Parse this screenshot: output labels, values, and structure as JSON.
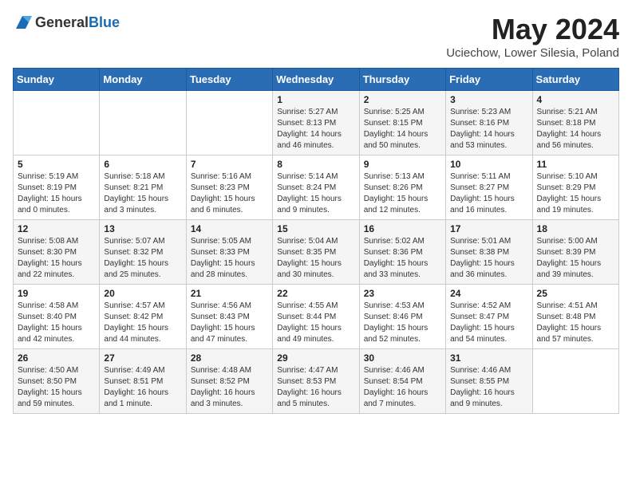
{
  "header": {
    "logo_general": "General",
    "logo_blue": "Blue",
    "month_title": "May 2024",
    "location": "Uciechow, Lower Silesia, Poland"
  },
  "days_of_week": [
    "Sunday",
    "Monday",
    "Tuesday",
    "Wednesday",
    "Thursday",
    "Friday",
    "Saturday"
  ],
  "weeks": [
    [
      {
        "day": "",
        "sunrise": "",
        "sunset": "",
        "daylight": ""
      },
      {
        "day": "",
        "sunrise": "",
        "sunset": "",
        "daylight": ""
      },
      {
        "day": "",
        "sunrise": "",
        "sunset": "",
        "daylight": ""
      },
      {
        "day": "1",
        "sunrise": "Sunrise: 5:27 AM",
        "sunset": "Sunset: 8:13 PM",
        "daylight": "Daylight: 14 hours and 46 minutes."
      },
      {
        "day": "2",
        "sunrise": "Sunrise: 5:25 AM",
        "sunset": "Sunset: 8:15 PM",
        "daylight": "Daylight: 14 hours and 50 minutes."
      },
      {
        "day": "3",
        "sunrise": "Sunrise: 5:23 AM",
        "sunset": "Sunset: 8:16 PM",
        "daylight": "Daylight: 14 hours and 53 minutes."
      },
      {
        "day": "4",
        "sunrise": "Sunrise: 5:21 AM",
        "sunset": "Sunset: 8:18 PM",
        "daylight": "Daylight: 14 hours and 56 minutes."
      }
    ],
    [
      {
        "day": "5",
        "sunrise": "Sunrise: 5:19 AM",
        "sunset": "Sunset: 8:19 PM",
        "daylight": "Daylight: 15 hours and 0 minutes."
      },
      {
        "day": "6",
        "sunrise": "Sunrise: 5:18 AM",
        "sunset": "Sunset: 8:21 PM",
        "daylight": "Daylight: 15 hours and 3 minutes."
      },
      {
        "day": "7",
        "sunrise": "Sunrise: 5:16 AM",
        "sunset": "Sunset: 8:23 PM",
        "daylight": "Daylight: 15 hours and 6 minutes."
      },
      {
        "day": "8",
        "sunrise": "Sunrise: 5:14 AM",
        "sunset": "Sunset: 8:24 PM",
        "daylight": "Daylight: 15 hours and 9 minutes."
      },
      {
        "day": "9",
        "sunrise": "Sunrise: 5:13 AM",
        "sunset": "Sunset: 8:26 PM",
        "daylight": "Daylight: 15 hours and 12 minutes."
      },
      {
        "day": "10",
        "sunrise": "Sunrise: 5:11 AM",
        "sunset": "Sunset: 8:27 PM",
        "daylight": "Daylight: 15 hours and 16 minutes."
      },
      {
        "day": "11",
        "sunrise": "Sunrise: 5:10 AM",
        "sunset": "Sunset: 8:29 PM",
        "daylight": "Daylight: 15 hours and 19 minutes."
      }
    ],
    [
      {
        "day": "12",
        "sunrise": "Sunrise: 5:08 AM",
        "sunset": "Sunset: 8:30 PM",
        "daylight": "Daylight: 15 hours and 22 minutes."
      },
      {
        "day": "13",
        "sunrise": "Sunrise: 5:07 AM",
        "sunset": "Sunset: 8:32 PM",
        "daylight": "Daylight: 15 hours and 25 minutes."
      },
      {
        "day": "14",
        "sunrise": "Sunrise: 5:05 AM",
        "sunset": "Sunset: 8:33 PM",
        "daylight": "Daylight: 15 hours and 28 minutes."
      },
      {
        "day": "15",
        "sunrise": "Sunrise: 5:04 AM",
        "sunset": "Sunset: 8:35 PM",
        "daylight": "Daylight: 15 hours and 30 minutes."
      },
      {
        "day": "16",
        "sunrise": "Sunrise: 5:02 AM",
        "sunset": "Sunset: 8:36 PM",
        "daylight": "Daylight: 15 hours and 33 minutes."
      },
      {
        "day": "17",
        "sunrise": "Sunrise: 5:01 AM",
        "sunset": "Sunset: 8:38 PM",
        "daylight": "Daylight: 15 hours and 36 minutes."
      },
      {
        "day": "18",
        "sunrise": "Sunrise: 5:00 AM",
        "sunset": "Sunset: 8:39 PM",
        "daylight": "Daylight: 15 hours and 39 minutes."
      }
    ],
    [
      {
        "day": "19",
        "sunrise": "Sunrise: 4:58 AM",
        "sunset": "Sunset: 8:40 PM",
        "daylight": "Daylight: 15 hours and 42 minutes."
      },
      {
        "day": "20",
        "sunrise": "Sunrise: 4:57 AM",
        "sunset": "Sunset: 8:42 PM",
        "daylight": "Daylight: 15 hours and 44 minutes."
      },
      {
        "day": "21",
        "sunrise": "Sunrise: 4:56 AM",
        "sunset": "Sunset: 8:43 PM",
        "daylight": "Daylight: 15 hours and 47 minutes."
      },
      {
        "day": "22",
        "sunrise": "Sunrise: 4:55 AM",
        "sunset": "Sunset: 8:44 PM",
        "daylight": "Daylight: 15 hours and 49 minutes."
      },
      {
        "day": "23",
        "sunrise": "Sunrise: 4:53 AM",
        "sunset": "Sunset: 8:46 PM",
        "daylight": "Daylight: 15 hours and 52 minutes."
      },
      {
        "day": "24",
        "sunrise": "Sunrise: 4:52 AM",
        "sunset": "Sunset: 8:47 PM",
        "daylight": "Daylight: 15 hours and 54 minutes."
      },
      {
        "day": "25",
        "sunrise": "Sunrise: 4:51 AM",
        "sunset": "Sunset: 8:48 PM",
        "daylight": "Daylight: 15 hours and 57 minutes."
      }
    ],
    [
      {
        "day": "26",
        "sunrise": "Sunrise: 4:50 AM",
        "sunset": "Sunset: 8:50 PM",
        "daylight": "Daylight: 15 hours and 59 minutes."
      },
      {
        "day": "27",
        "sunrise": "Sunrise: 4:49 AM",
        "sunset": "Sunset: 8:51 PM",
        "daylight": "Daylight: 16 hours and 1 minute."
      },
      {
        "day": "28",
        "sunrise": "Sunrise: 4:48 AM",
        "sunset": "Sunset: 8:52 PM",
        "daylight": "Daylight: 16 hours and 3 minutes."
      },
      {
        "day": "29",
        "sunrise": "Sunrise: 4:47 AM",
        "sunset": "Sunset: 8:53 PM",
        "daylight": "Daylight: 16 hours and 5 minutes."
      },
      {
        "day": "30",
        "sunrise": "Sunrise: 4:46 AM",
        "sunset": "Sunset: 8:54 PM",
        "daylight": "Daylight: 16 hours and 7 minutes."
      },
      {
        "day": "31",
        "sunrise": "Sunrise: 4:46 AM",
        "sunset": "Sunset: 8:55 PM",
        "daylight": "Daylight: 16 hours and 9 minutes."
      },
      {
        "day": "",
        "sunrise": "",
        "sunset": "",
        "daylight": ""
      }
    ]
  ]
}
